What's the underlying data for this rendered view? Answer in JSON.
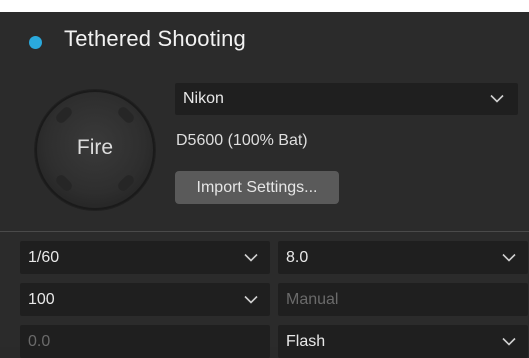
{
  "panel": {
    "title": "Tethered Shooting",
    "status_dot_color": "#2aa9dc",
    "fire_label": "Fire",
    "camera_brand": "Nikon",
    "camera_info": "D5600 (100% Bat)",
    "import_settings_label": "Import Settings..."
  },
  "controls": {
    "shutter_speed": "1/60",
    "aperture": "8.0",
    "iso": "100",
    "exposure_mode_placeholder": "Manual",
    "exposure_comp_placeholder": "0.0",
    "flash_mode": "Flash"
  },
  "icons": {
    "status": "status-dot-icon",
    "dropdown": "chevron-down-icon"
  }
}
